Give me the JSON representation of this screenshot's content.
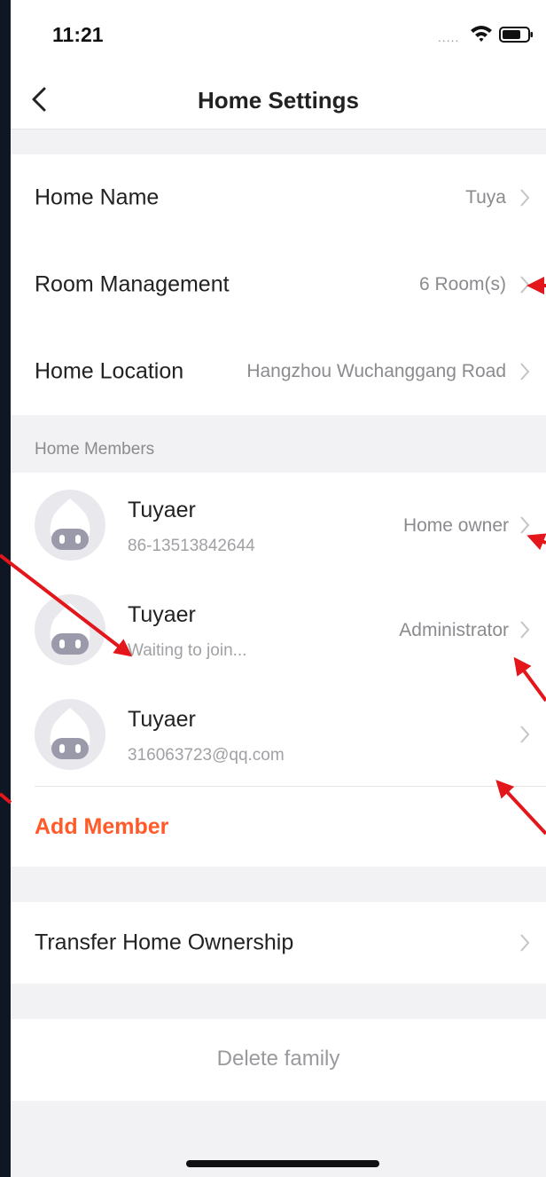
{
  "status_bar": {
    "time": "11:21",
    "signal": "....."
  },
  "header": {
    "title": "Home Settings"
  },
  "settings": {
    "home_name": {
      "label": "Home Name",
      "value": "Tuya"
    },
    "room_management": {
      "label": "Room Management",
      "value": "6 Room(s)"
    },
    "home_location": {
      "label": "Home Location",
      "value": "Hangzhou Wuchanggang Road"
    }
  },
  "members_section": {
    "title": "Home Members",
    "members": [
      {
        "name": "Tuyaer",
        "sub": "86-13513842644",
        "role": "Home owner"
      },
      {
        "name": "Tuyaer",
        "sub": "Waiting to join...",
        "role": "Administrator"
      },
      {
        "name": "Tuyaer",
        "sub": "316063723@qq.com",
        "role": ""
      }
    ],
    "add_member": "Add Member"
  },
  "transfer": {
    "label": "Transfer Home Ownership"
  },
  "delete": {
    "label": "Delete family"
  },
  "colors": {
    "accent": "#ff5a28",
    "annotation_arrow": "#e3161b"
  }
}
